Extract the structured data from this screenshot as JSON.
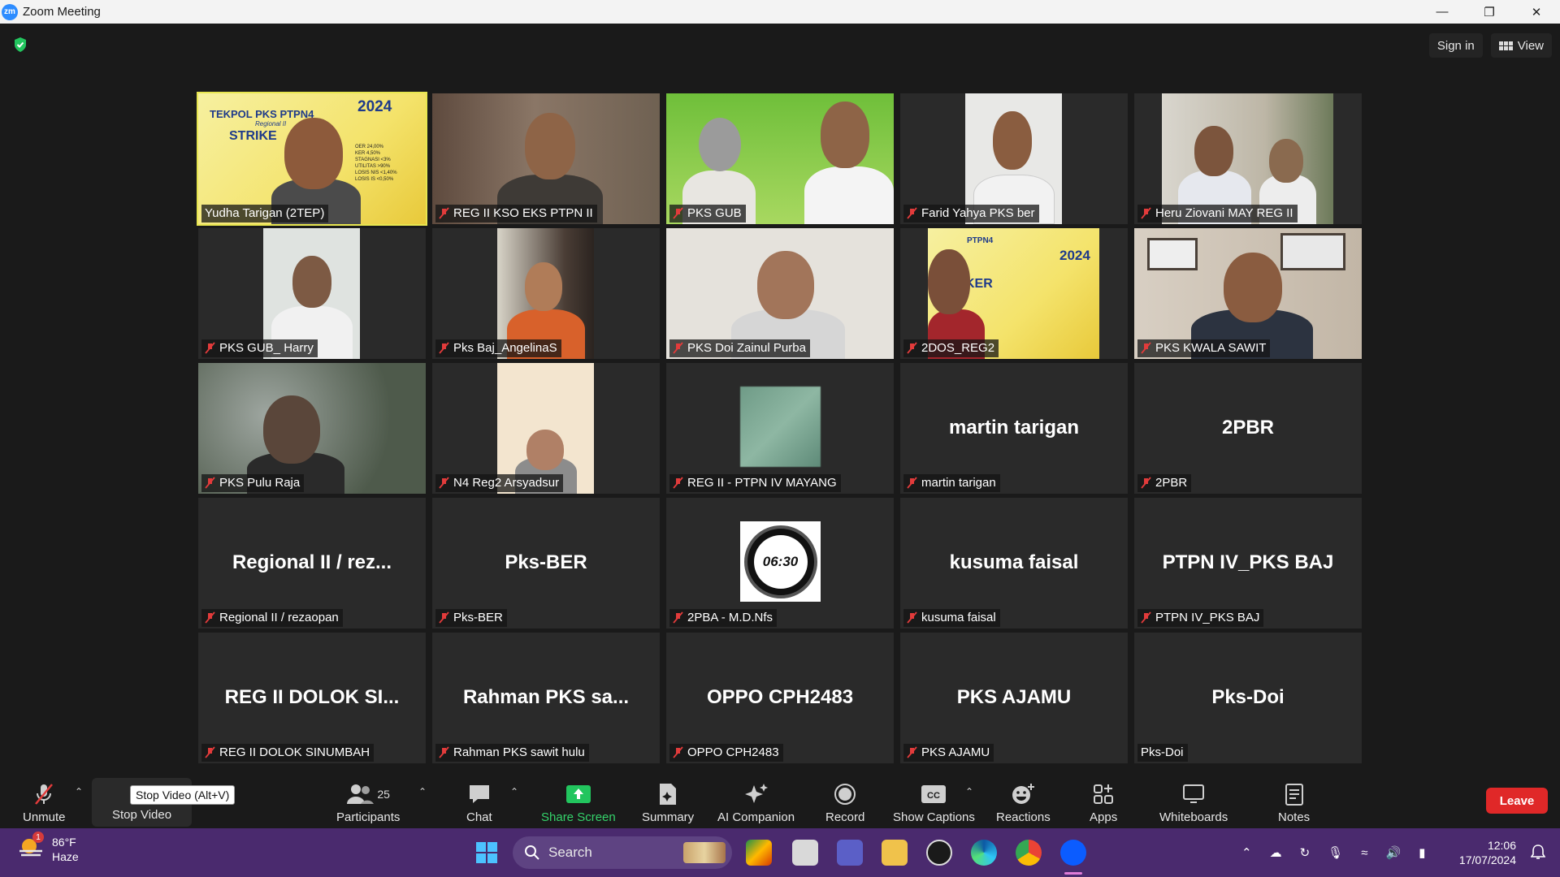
{
  "window": {
    "title": "Zoom Meeting",
    "app_icon": "zm"
  },
  "topbar": {
    "sign_in": "Sign in",
    "view": "View"
  },
  "tiles": [
    {
      "name": "Yudha Tarigan (2TEP)",
      "muted": false,
      "active": true,
      "video": true
    },
    {
      "name": "REG II KSO EKS PTPN II",
      "muted": true,
      "video": true
    },
    {
      "name": "PKS GUB",
      "muted": true,
      "video": true
    },
    {
      "name": "Farid Yahya PKS ber",
      "muted": true,
      "video": true
    },
    {
      "name": "Heru Ziovani MAY REG II",
      "muted": true,
      "video": true
    },
    {
      "name": "PKS GUB_ Harry",
      "muted": true,
      "video": true
    },
    {
      "name": "Pks Baj_AngelinaS",
      "muted": true,
      "video": true
    },
    {
      "name": "PKS Doi Zainul Purba",
      "muted": true,
      "video": true
    },
    {
      "name": "2DOS_REG2",
      "muted": true,
      "video": true
    },
    {
      "name": "PKS KWALA SAWIT",
      "muted": true,
      "video": true
    },
    {
      "name": "PKS Pulu Raja",
      "muted": true,
      "video": true
    },
    {
      "name": "N4 Reg2 Arsyadsur",
      "muted": true,
      "video": true
    },
    {
      "name": "REG II - PTPN IV  MAYANG",
      "muted": true,
      "video": true
    },
    {
      "name": "martin tarigan",
      "muted": true,
      "center": "martin tarigan"
    },
    {
      "name": "2PBR",
      "muted": true,
      "center": "2PBR"
    },
    {
      "name": "Regional II / rezaopan",
      "muted": true,
      "center": "Regional II / rez..."
    },
    {
      "name": "Pks-BER",
      "muted": true,
      "center": "Pks-BER"
    },
    {
      "name": "2PBA - M.D.Nfs",
      "muted": true,
      "video": true
    },
    {
      "name": "kusuma faisal",
      "muted": true,
      "center": "kusuma faisal"
    },
    {
      "name": "PTPN IV_PKS BAJ",
      "muted": true,
      "center": "PTPN IV_PKS BAJ"
    },
    {
      "name": "REG II DOLOK SINUMBAH",
      "muted": true,
      "center": "REG II DOLOK SI..."
    },
    {
      "name": "Rahman PKS sawit hulu",
      "muted": true,
      "center": "Rahman PKS sa..."
    },
    {
      "name": "OPPO CPH2483",
      "muted": true,
      "center": "OPPO CPH2483"
    },
    {
      "name": "PKS AJAMU",
      "muted": true,
      "center": "PKS AJAMU"
    },
    {
      "name": "Pks-Doi",
      "muted": false,
      "center": "Pks-Doi"
    }
  ],
  "tile_texts": {
    "banner_year": "2024",
    "banner_title": "TEKPOL PKS PTPN4",
    "banner_sub": "Regional II",
    "banner_word": "STRIKE",
    "banner_kpis": [
      "OER 24,00%",
      "KER 4,50%",
      "STAGNASI <3%",
      "UTILITAS >90%",
      "LOSIS NIS <1,40%",
      "LOSIS IS <0,50%"
    ],
    "banner2_word": "KER",
    "banner2_top": "PTPN4",
    "clock_badge": "06:30"
  },
  "toolbar": {
    "unmute": "Unmute",
    "stop_video": "Stop Video",
    "tooltip": "Stop Video (Alt+V)",
    "participants": "Participants",
    "participants_count": "25",
    "chat": "Chat",
    "share_screen": "Share Screen",
    "summary": "Summary",
    "ai_companion": "AI Companion",
    "record": "Record",
    "show_captions": "Show Captions",
    "reactions": "Reactions",
    "apps": "Apps",
    "whiteboards": "Whiteboards",
    "notes": "Notes",
    "leave": "Leave"
  },
  "taskbar": {
    "temperature": "86°F",
    "weather": "Haze",
    "weather_badge": "1",
    "search": "Search",
    "time": "12:06",
    "date": "17/07/2024"
  },
  "colors": {
    "accent_green": "#22c55e",
    "leave_red": "#e02828",
    "active_border": "#e8e650",
    "taskbar": "#4a2a6e"
  }
}
